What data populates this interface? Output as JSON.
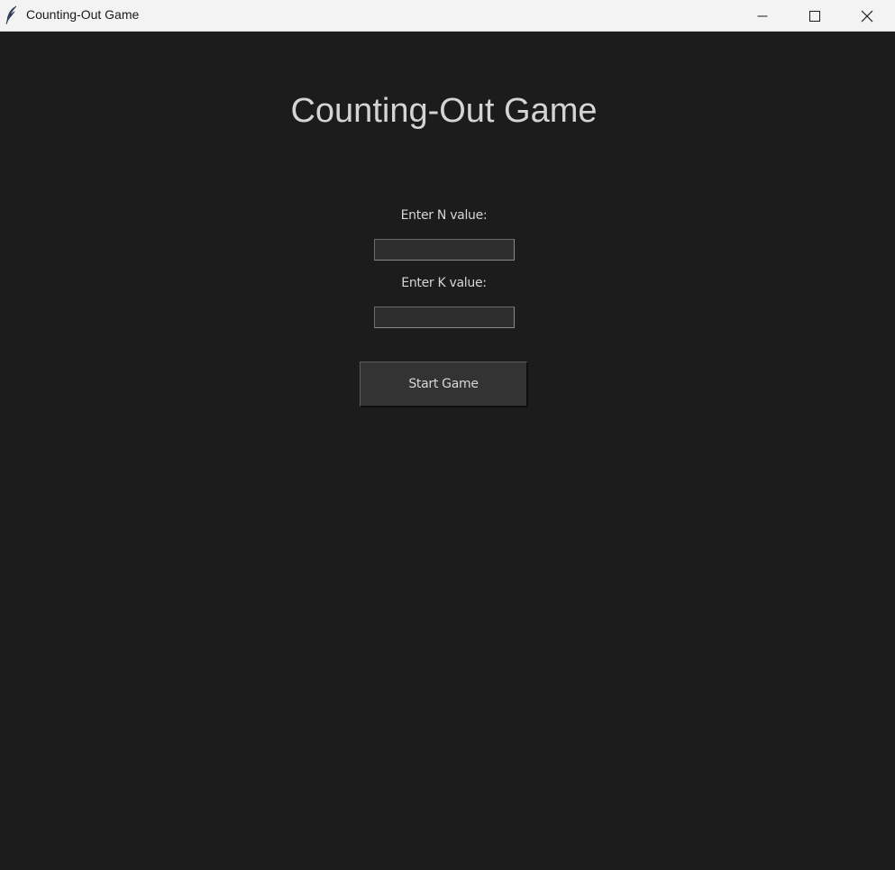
{
  "window": {
    "title": "Counting-Out Game",
    "icon": "feather-icon"
  },
  "controls": {
    "minimize": "minimize-icon",
    "maximize": "maximize-icon",
    "close": "close-icon"
  },
  "main": {
    "heading": "Counting-Out Game",
    "n_label": "Enter N value:",
    "n_value": "",
    "k_label": "Enter K value:",
    "k_value": "",
    "start_button": "Start Game"
  },
  "colors": {
    "background": "#1c1c1c",
    "titlebar": "#f3f3f3",
    "text": "#d4d4d4",
    "entry_bg": "#2e2e2e",
    "button_bg": "#333333"
  }
}
